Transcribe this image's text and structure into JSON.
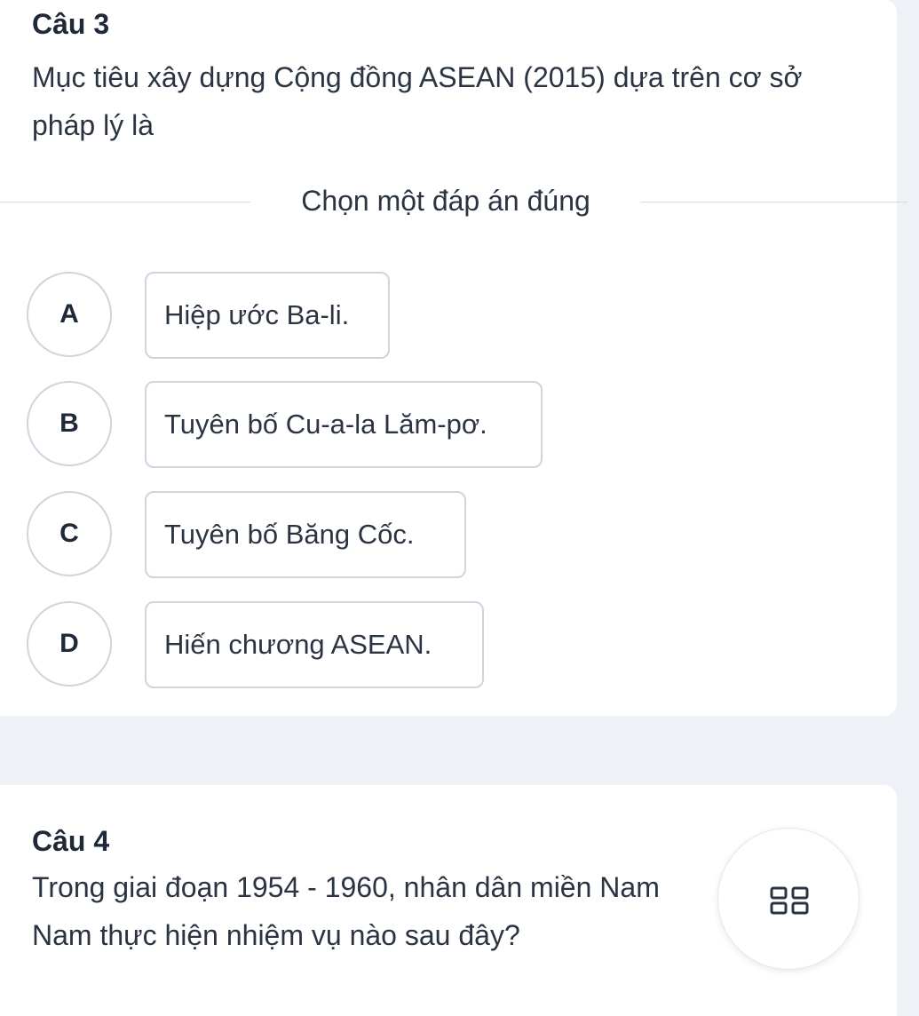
{
  "question3": {
    "label": "Câu 3",
    "text": "Mục tiêu xây dựng Cộng đồng ASEAN (2015) dựa trên cơ sở pháp lý là",
    "instruction": "Chọn một đáp án đúng",
    "options": [
      {
        "letter": "A",
        "text": "Hiệp ước Ba-li."
      },
      {
        "letter": "B",
        "text": "Tuyên bố Cu-a-la Lăm-pơ."
      },
      {
        "letter": "C",
        "text": "Tuyên bố Băng Cốc."
      },
      {
        "letter": "D",
        "text": "Hiến chương ASEAN."
      }
    ]
  },
  "question4": {
    "label": "Câu 4",
    "text": "Trong giai đoạn 1954 - 1960, nhân dân miền Nam Nam thực hiện nhiệm vụ nào sau đây?"
  },
  "fab": {
    "icon": "grid-icon"
  }
}
